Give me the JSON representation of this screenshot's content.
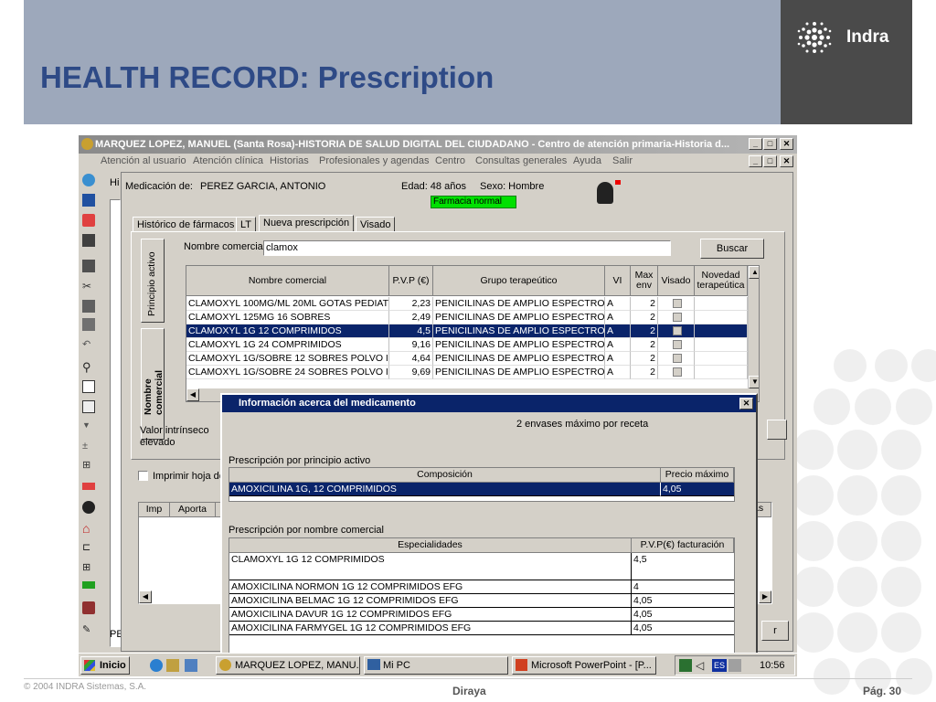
{
  "slide": {
    "title": "HEALTH RECORD: Prescription",
    "brand": "Indra",
    "copyright": "© 2004 INDRA Sistemas, S.A.",
    "footer_center": "Diraya",
    "page": "Pág. 30"
  },
  "window": {
    "title": "MARQUEZ LOPEZ, MANUEL (Santa Rosa)-HISTORIA DE SALUD DIGITAL  DEL CIUDADANO - Centro de atención primaria-Historia d...",
    "min": "_",
    "max": "□",
    "close": "✕"
  },
  "menu": [
    "Atención al usuario",
    "Atención clínica",
    "Historias",
    "Profesionales y agendas",
    "Centro",
    "Consultas generales",
    "Ayuda",
    "Salir"
  ],
  "patient": {
    "left_clip": "Hi",
    "med_label": "Medicación de:",
    "name": "PEREZ GARCIA, ANTONIO",
    "age": "Edad: 48 años",
    "sex": "Sexo: Hombre",
    "pharmacy": "Farmacia normal"
  },
  "tabs": [
    "Histórico de fármacos",
    "LT",
    "Nueva prescripción",
    "Visado"
  ],
  "vtabs": [
    "Principio activo",
    "Nombre comercial"
  ],
  "search": {
    "label": "Nombre comercial:",
    "value": "clamox",
    "button": "Buscar"
  },
  "grid": {
    "headers": [
      "Nombre comercial",
      "P.V.P (€)",
      "Grupo terapeútico",
      "VI",
      "Max env",
      "Visado",
      "Novedad terapeútica"
    ],
    "rows": [
      [
        "CLAMOXYL 100MG/ML 20ML GOTAS PEDIAT",
        "2,23",
        "PENICILINAS DE AMPLIO ESPECTRO",
        "A",
        "2"
      ],
      [
        "CLAMOXYL 125MG 16 SOBRES",
        "2,49",
        "PENICILINAS DE AMPLIO ESPECTRO",
        "A",
        "2"
      ],
      [
        "CLAMOXYL 1G 12 COMPRIMIDOS",
        "4,5",
        "PENICILINAS DE AMPLIO ESPECTRO",
        "A",
        "2"
      ],
      [
        "CLAMOXYL 1G 24 COMPRIMIDOS",
        "9,16",
        "PENICILINAS DE AMPLIO ESPECTRO",
        "A",
        "2"
      ],
      [
        "CLAMOXYL 1G/SOBRE 12 SOBRES POLVO I",
        "4,64",
        "PENICILINAS DE AMPLIO ESPECTRO",
        "A",
        "2"
      ],
      [
        "CLAMOXYL 1G/SOBRE 24 SOBRES POLVO I",
        "9,69",
        "PENICILINAS DE AMPLIO ESPECTRO",
        "A",
        "2"
      ]
    ]
  },
  "lower": {
    "valor": "Valor intrínseco elevado",
    "imprimir": "Imprimir hoja de",
    "col_imp": "Imp",
    "col_aporta": "Aporta",
    "pe_clip": "PE",
    "as_clip": "as",
    "r_clip": "r"
  },
  "dialog": {
    "title": "Información acerca del medicamento",
    "note": "2 envases máximo por receta",
    "sec1": "Prescripción por principio activo",
    "t1_headers": [
      "Composición",
      "Precio máximo"
    ],
    "t1_rows": [
      [
        "AMOXICILINA 1G, 12 COMPRIMIDOS",
        "4,05"
      ]
    ],
    "sec2": "Prescripción por nombre comercial",
    "t2_headers": [
      "Especialidades",
      "P.V.P(€) facturación"
    ],
    "t2_first": [
      "CLAMOXYL 1G 12 COMPRIMIDOS",
      "4,5"
    ],
    "t2_rows": [
      [
        "AMOXICILINA NORMON 1G 12 COMPRIMIDOS EFG",
        "4"
      ],
      [
        "AMOXICILINA BELMAC 1G 12 COMPRIMIDOS EFG",
        "4,05"
      ],
      [
        "AMOXICILINA DAVUR 1G 12 COMPRIMIDOS EFG",
        "4,05"
      ],
      [
        "AMOXICILINA FARMYGEL 1G 12 COMPRIMIDOS EFG",
        "4,05"
      ]
    ]
  },
  "taskbar": {
    "start": "Inicio",
    "items": [
      "MARQUEZ LOPEZ, MANU...",
      "Mi PC",
      "Microsoft PowerPoint - [P..."
    ],
    "lang": "ES",
    "time": "10:56"
  },
  "colors": {
    "accent": "#2e4a86",
    "selection": "#0a246a",
    "pharmacy_bg": "#00e000",
    "logo_bg": "#4a4a4a"
  }
}
